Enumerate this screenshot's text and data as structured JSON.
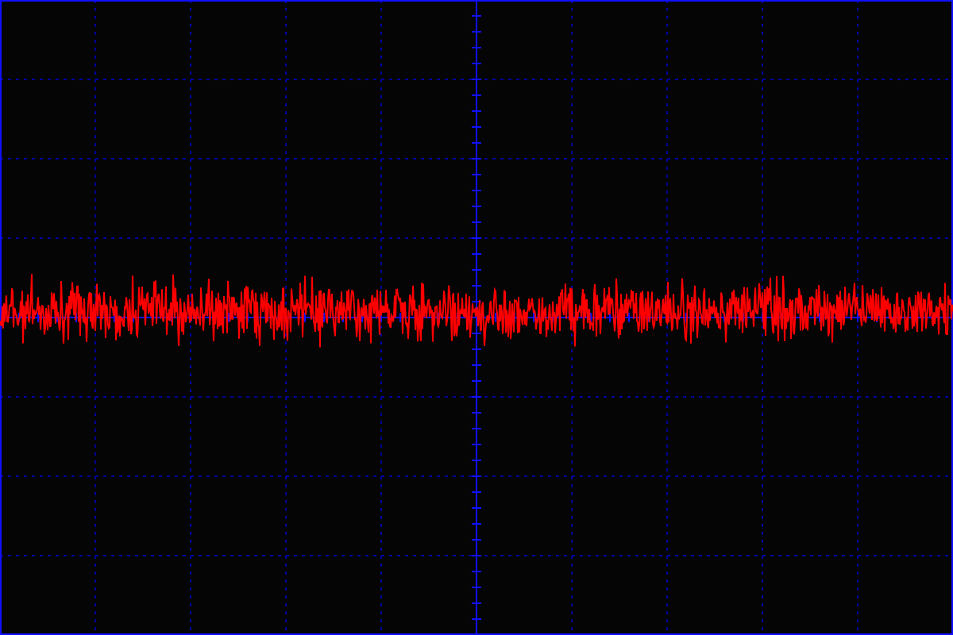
{
  "screen": {
    "grid_visible": true,
    "trace_visible": true
  }
}
